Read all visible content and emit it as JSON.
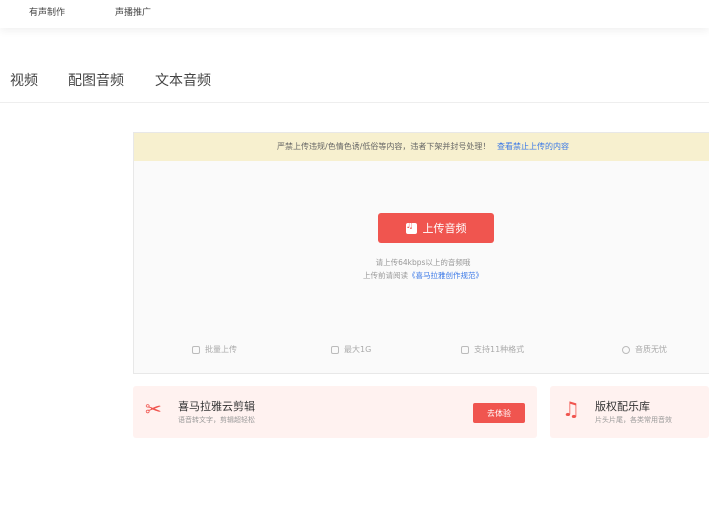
{
  "topnav": {
    "item1": "有声制作",
    "item2": "声播推广"
  },
  "tabs": [
    "视频",
    "配图音频",
    "文本音频"
  ],
  "upload": {
    "warning": "严禁上传违规/色情色诱/低俗等内容，违者下架并封号处理！",
    "warning_link": "查看禁止上传的内容",
    "button_label": "上传音频",
    "hint_line1": "请上传64kbps以上的音频哦",
    "hint_line2_prefix": "上传前请阅读",
    "hint_line2_link": "《喜马拉雅创作规范》",
    "features": [
      "批量上传",
      "最大1G",
      "支持11种格式",
      "音质无忧"
    ]
  },
  "promos": [
    {
      "icon": "scissors-icon",
      "title": "喜马拉雅云剪辑",
      "subtitle": "语音转文字，剪辑超轻松",
      "button": "去体验"
    },
    {
      "icon": "music-note-icon",
      "title": "版权配乐库",
      "subtitle": "片头片尾，各类常用音效"
    }
  ],
  "colors": {
    "accent": "#f0554f",
    "link": "#3a78e7",
    "warn_bg": "#f7f0cf"
  }
}
